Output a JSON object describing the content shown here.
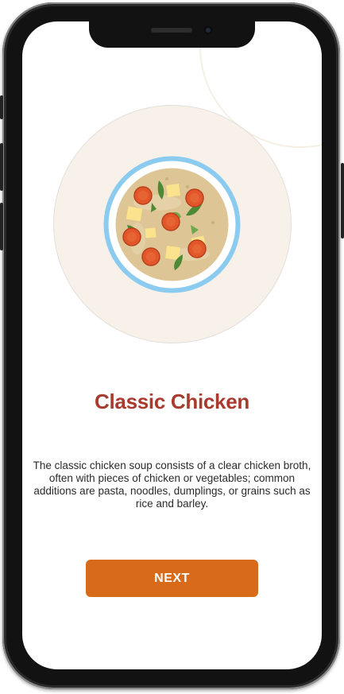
{
  "screen": {
    "title": "Classic Chicken",
    "description": "The classic chicken soup consists of a clear chicken broth, often with pieces of chicken or vegetables; common additions are pasta, noodles, dumplings, or grains such as rice and barley.",
    "next_label": "NEXT"
  },
  "illustration": {
    "icon": "chicken-soup-bowl-icon"
  },
  "colors": {
    "title": "#a83a2e",
    "button": "#d76b1a",
    "bowl_rim": "#8ccbf0",
    "broth": "#ddc596",
    "carrot": "#e2562a",
    "herb": "#4e8a35",
    "chicken": "#fae38c"
  }
}
